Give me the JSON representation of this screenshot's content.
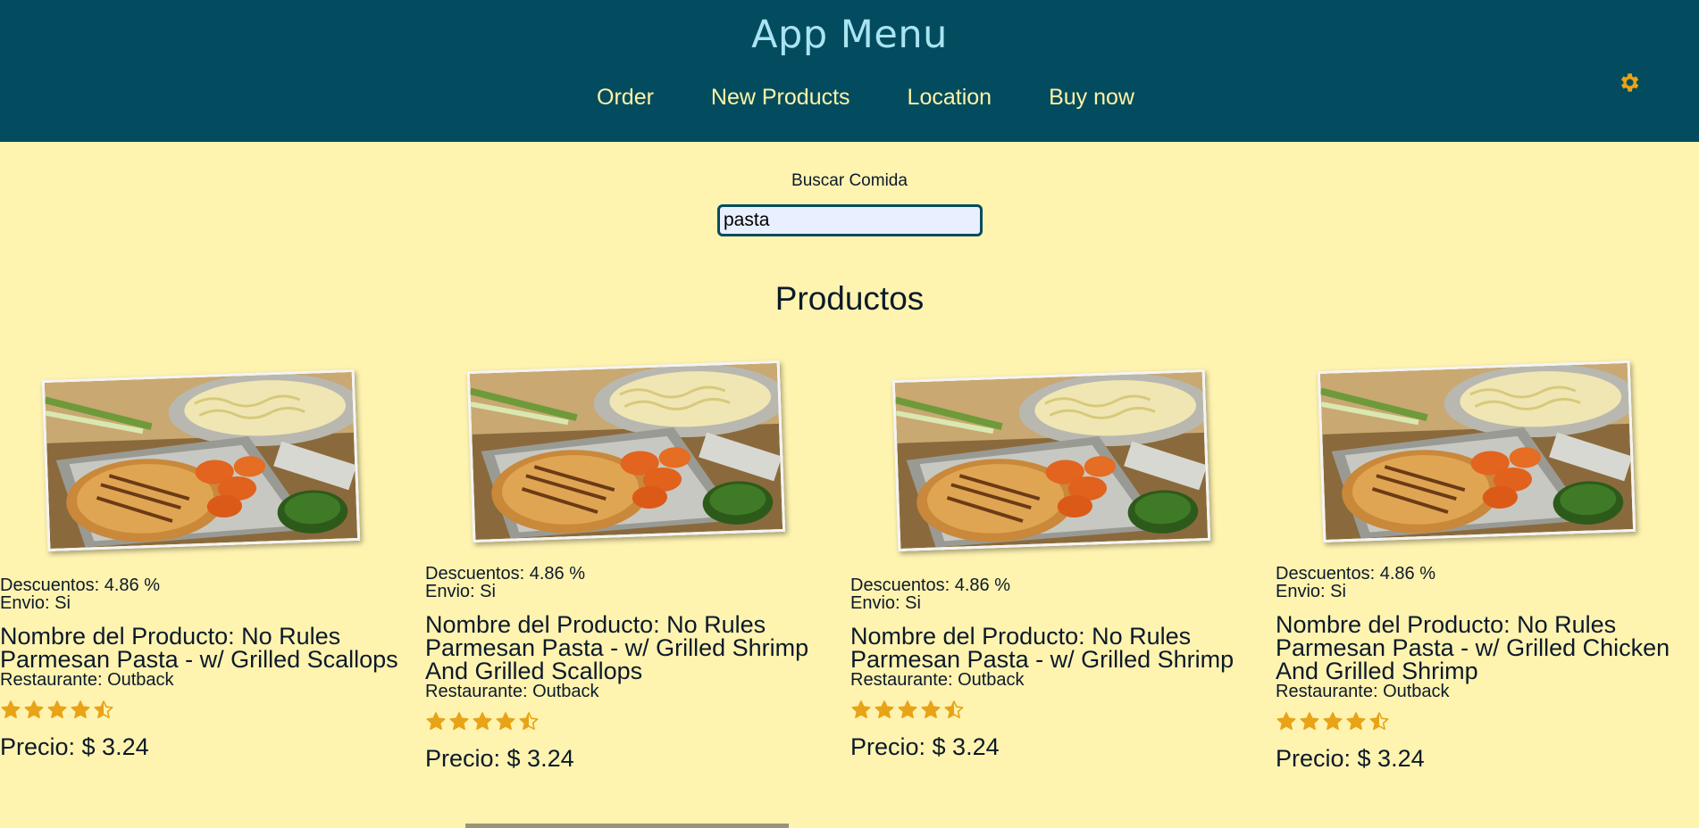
{
  "header": {
    "title": "App Menu",
    "nav": [
      "Order",
      "New Products",
      "Location",
      "Buy now"
    ],
    "settings_icon": "gear-icon"
  },
  "search": {
    "label": "Buscar Comida",
    "value": "pasta"
  },
  "section_title": "Productos",
  "products": [
    {
      "discount": "Descuentos: 4.86 %",
      "shipping": "Envio: Si",
      "name": "Nombre del Producto: No Rules Parmesan Pasta - w/ Grilled Scallops",
      "restaurant": "Restaurante: Outback",
      "rating": 4.5,
      "price": "Precio: $ 3.24"
    },
    {
      "discount": "Descuentos: 4.86 %",
      "shipping": "Envio: Si",
      "name": "Nombre del Producto: No Rules Parmesan Pasta - w/ Grilled Shrimp And Grilled Scallops",
      "restaurant": "Restaurante: Outback",
      "rating": 4.5,
      "price": "Precio: $ 3.24"
    },
    {
      "discount": "Descuentos: 4.86 %",
      "shipping": "Envio: Si",
      "name": "Nombre del Producto: No Rules Parmesan Pasta - w/ Grilled Shrimp",
      "restaurant": "Restaurante: Outback",
      "rating": 4.5,
      "price": "Precio: $ 3.24"
    },
    {
      "discount": "Descuentos: 4.86 %",
      "shipping": "Envio: Si",
      "name": "Nombre del Producto: No Rules Parmesan Pasta - w/ Grilled Chicken And Grilled Shrimp",
      "restaurant": "Restaurante: Outback",
      "rating": 4.5,
      "price": "Precio: $ 3.24"
    }
  ],
  "colors": {
    "header_bg": "#034c5f",
    "page_bg": "#fff3b0",
    "title": "#a9e4f2",
    "nav_text": "#fff3a6",
    "accent_star": "#e8a317"
  }
}
